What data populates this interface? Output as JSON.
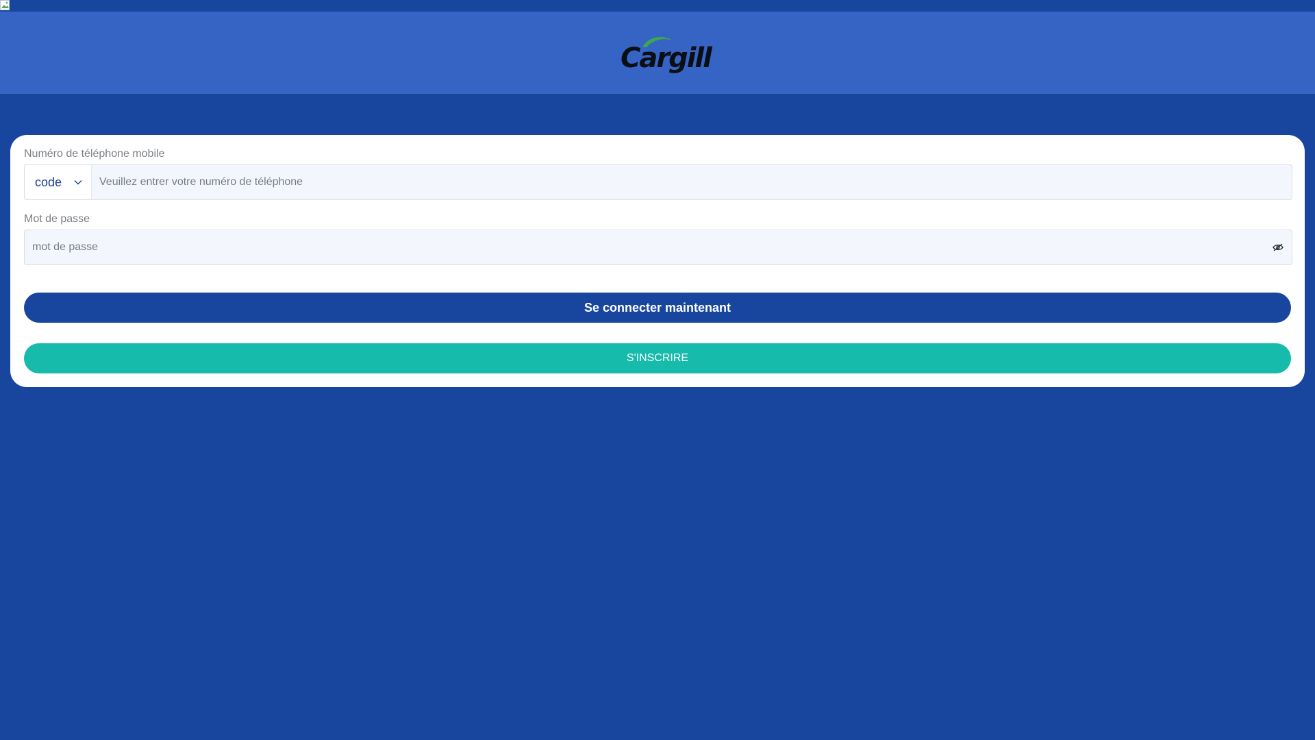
{
  "brand": {
    "logo_text": "Cargill",
    "colors": {
      "page_bg": "#18469e",
      "header_bg": "#3664c5",
      "primary": "#18469e",
      "secondary": "#16bbab",
      "logo_leaf": "#3ea84a"
    }
  },
  "form": {
    "phone_label": "Numéro de téléphone mobile",
    "code_label": "code",
    "phone_placeholder": "Veuillez entrer votre numéro de téléphone",
    "password_label": "Mot de passe",
    "password_placeholder": "mot de passe",
    "login_button": "Se connecter maintenant",
    "register_button": "S'INSCRIRE"
  },
  "icons": {
    "broken_image": "broken-image-icon",
    "code_dropdown": "chevron-down-icon",
    "password_toggle": "eye-icon"
  }
}
